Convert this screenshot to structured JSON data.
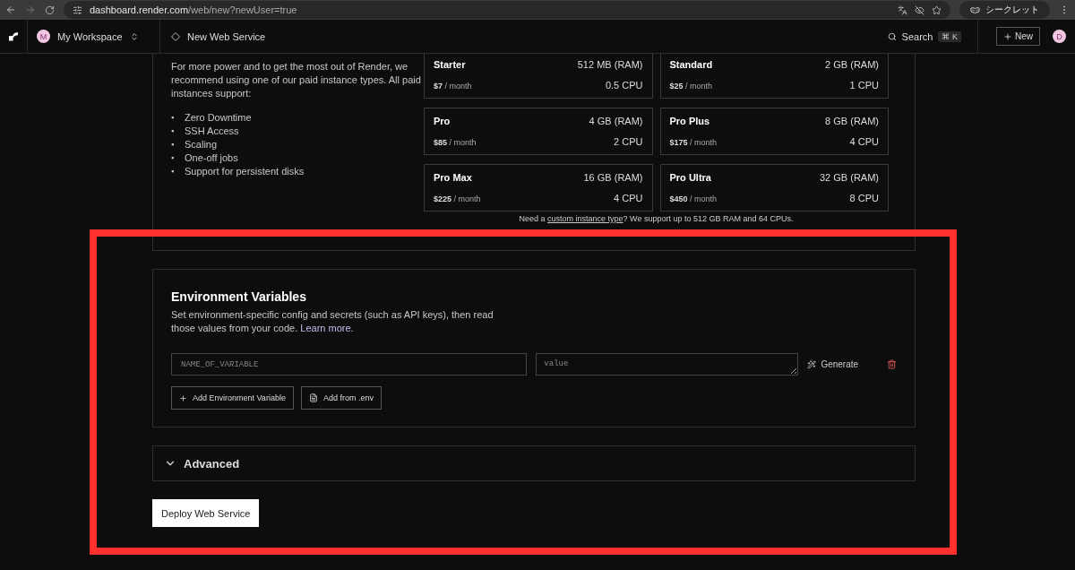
{
  "browser": {
    "url_host": "dashboard.render.com",
    "url_path": "/web/new?newUser=true",
    "incognito_label": "シークレット"
  },
  "header": {
    "workspace_initial": "M",
    "workspace_name": "My Workspace",
    "page_title": "New Web Service",
    "search_label": "Search",
    "search_shortcut": "⌘ K",
    "new_button": "New",
    "user_initial": "D"
  },
  "instances": {
    "description": "For more power and to get the most out of Render, we recommend using one of our paid instance types. All paid instances support:",
    "bullet": "▪",
    "features": [
      "Zero Downtime",
      "SSH Access",
      "Scaling",
      "One-off jobs",
      "Support for persistent disks"
    ],
    "plans": [
      {
        "name": "Starter",
        "ram": "512 MB (RAM)",
        "price": "$7",
        "period": "/ month",
        "cpu": "0.5 CPU"
      },
      {
        "name": "Standard",
        "ram": "2 GB (RAM)",
        "price": "$25",
        "period": "/ month",
        "cpu": "1 CPU"
      },
      {
        "name": "Pro",
        "ram": "4 GB (RAM)",
        "price": "$85",
        "period": "/ month",
        "cpu": "2 CPU"
      },
      {
        "name": "Pro Plus",
        "ram": "8 GB (RAM)",
        "price": "$175",
        "period": "/ month",
        "cpu": "4 CPU"
      },
      {
        "name": "Pro Max",
        "ram": "16 GB (RAM)",
        "price": "$225",
        "period": "/ month",
        "cpu": "4 CPU"
      },
      {
        "name": "Pro Ultra",
        "ram": "32 GB (RAM)",
        "price": "$450",
        "period": "/ month",
        "cpu": "8 CPU"
      }
    ],
    "custom_note": {
      "before": "Need a ",
      "link": "custom instance type",
      "after": "? We support up to 512 GB RAM and 64 CPUs."
    }
  },
  "env": {
    "title": "Environment Variables",
    "description": "Set environment-specific config and secrets (such as API keys), then read those values from your code.",
    "learn_more": "Learn more.",
    "name_placeholder": "NAME_OF_VARIABLE",
    "value_placeholder": "value",
    "generate": "Generate",
    "add_variable": "Add Environment Variable",
    "add_from_env": "Add from .env"
  },
  "advanced": {
    "label": "Advanced",
    "expanded": false
  },
  "deploy_button": "Deploy Web Service"
}
